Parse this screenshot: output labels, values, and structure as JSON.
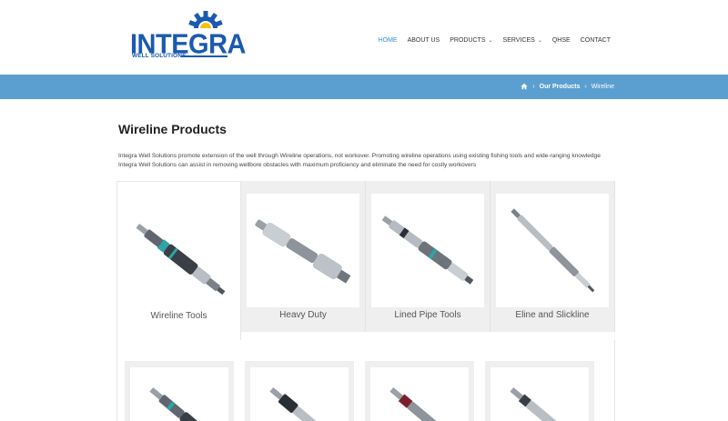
{
  "logo": {
    "brand": "INTEGRA",
    "subtitle": "WELL SOLUTIONS"
  },
  "nav": {
    "items": [
      {
        "label": "HOME",
        "active": true
      },
      {
        "label": "ABOUT US"
      },
      {
        "label": "PRODUCTS",
        "dropdown": true
      },
      {
        "label": "SERVICES",
        "dropdown": true
      },
      {
        "label": "QHSE"
      },
      {
        "label": "CONTACT"
      }
    ]
  },
  "breadcrumb": {
    "items": [
      "Our Products",
      "Wireline"
    ],
    "separator": "›"
  },
  "page": {
    "title": "Wireline Products",
    "intro": "Integra Well Solutions promote extension of the well through Wireline operations, not workover. Promoting wireline operations using existing fishing tools and wide-ranging knowledge Integra Well Solutions can assist in removing wellbore obstacles with maximum proficiency and eliminate the need for costly workovers"
  },
  "tabs": [
    {
      "label": "Wireline Tools",
      "active": true
    },
    {
      "label": "Heavy Duty"
    },
    {
      "label": "Lined Pipe Tools"
    },
    {
      "label": "Eline and Slickline"
    }
  ],
  "colors": {
    "brand_blue": "#1a5ab0",
    "gear_blue": "#1a5ab0",
    "sun_yellow": "#f4c20d",
    "crumb_bar": "#5b9fd0",
    "nav_active": "#3a8ed0"
  }
}
